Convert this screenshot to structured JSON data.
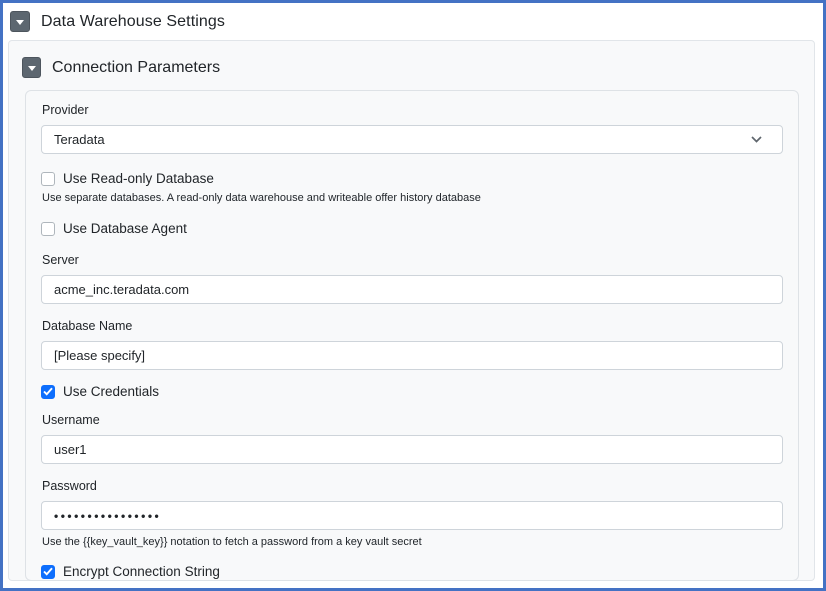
{
  "page": {
    "title": "Data Warehouse Settings"
  },
  "section": {
    "title": "Connection Parameters"
  },
  "form": {
    "provider": {
      "label": "Provider",
      "value": "Teradata"
    },
    "read_only_database": {
      "label": "Use Read-only Database",
      "checked": false,
      "help": "Use separate databases. A read-only data warehouse and writeable offer history database"
    },
    "database_agent": {
      "label": "Use Database Agent",
      "checked": false
    },
    "server": {
      "label": "Server",
      "value": "acme_inc.teradata.com"
    },
    "database_name": {
      "label": "Database Name",
      "value": "[Please specify]"
    },
    "use_credentials": {
      "label": "Use Credentials",
      "checked": true
    },
    "username": {
      "label": "Username",
      "value": "user1"
    },
    "password": {
      "label": "Password",
      "value": "••••••••••••••••",
      "help": "Use the {{key_vault_key}} notation to fetch a password from a key vault secret"
    },
    "encrypt_connection_string": {
      "label": "Encrypt Connection String",
      "checked": true
    }
  },
  "icons": {
    "section_toggle": "chevron-down",
    "select_indicator": "chevron-down",
    "checkbox_check": "check-mark"
  },
  "colors": {
    "frame_border": "#4472c4",
    "toggle_button": "#5d6770",
    "checkbox_checked": "#0d6efd",
    "panel_background": "#f8f9fa"
  }
}
